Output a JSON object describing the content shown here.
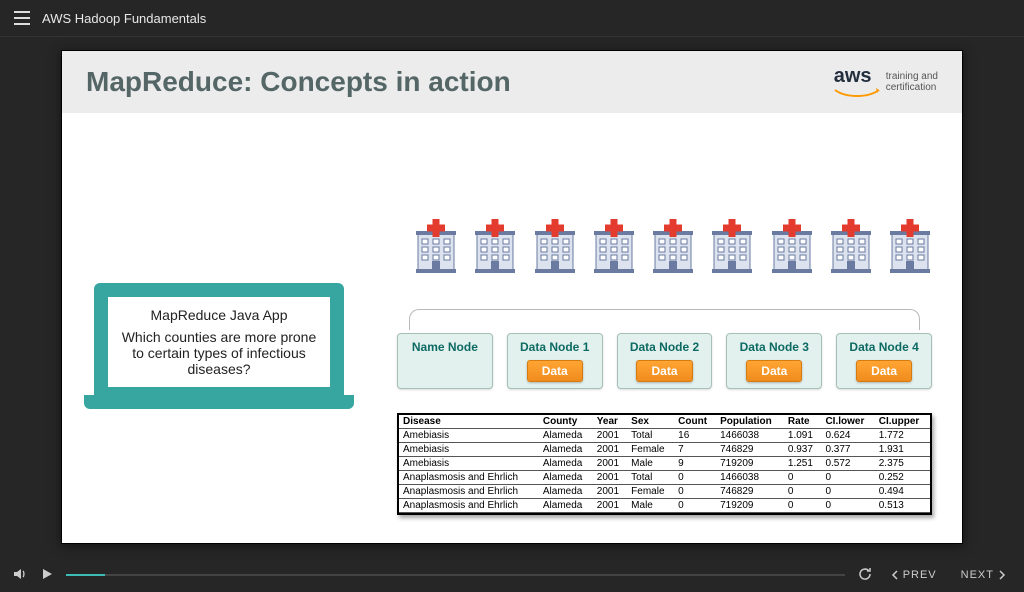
{
  "header": {
    "course_title": "AWS Hadoop Fundamentals"
  },
  "slide": {
    "title": "MapReduce: Concepts in action",
    "logo_mark": "aws",
    "logo_line1": "training and",
    "logo_line2": "certification"
  },
  "laptop": {
    "app_title": "MapReduce Java App",
    "question": "Which counties are more prone to certain types of infectious diseases?"
  },
  "nodes": {
    "name_node": "Name Node",
    "data_label": "Data",
    "items": [
      {
        "title": "Data Node 1"
      },
      {
        "title": "Data Node 2"
      },
      {
        "title": "Data Node 3"
      },
      {
        "title": "Data Node 4"
      }
    ]
  },
  "table": {
    "headers": [
      "Disease",
      "County",
      "Year",
      "Sex",
      "Count",
      "Population",
      "Rate",
      "CI.lower",
      "CI.upper"
    ],
    "rows": [
      [
        "Amebiasis",
        "Alameda",
        "2001",
        "Total",
        "16",
        "1466038",
        "1.091",
        "0.624",
        "1.772"
      ],
      [
        "Amebiasis",
        "Alameda",
        "2001",
        "Female",
        "7",
        "746829",
        "0.937",
        "0.377",
        "1.931"
      ],
      [
        "Amebiasis",
        "Alameda",
        "2001",
        "Male",
        "9",
        "719209",
        "1.251",
        "0.572",
        "2.375"
      ],
      [
        "Anaplasmosis and Ehrlich",
        "Alameda",
        "2001",
        "Total",
        "0",
        "1466038",
        "0",
        "0",
        "0.252"
      ],
      [
        "Anaplasmosis and Ehrlich",
        "Alameda",
        "2001",
        "Female",
        "0",
        "746829",
        "0",
        "0",
        "0.494"
      ],
      [
        "Anaplasmosis and Ehrlich",
        "Alameda",
        "2001",
        "Male",
        "0",
        "719209",
        "0",
        "0",
        "0.513"
      ]
    ]
  },
  "footer": {
    "prev": "PREV",
    "next": "NEXT"
  }
}
